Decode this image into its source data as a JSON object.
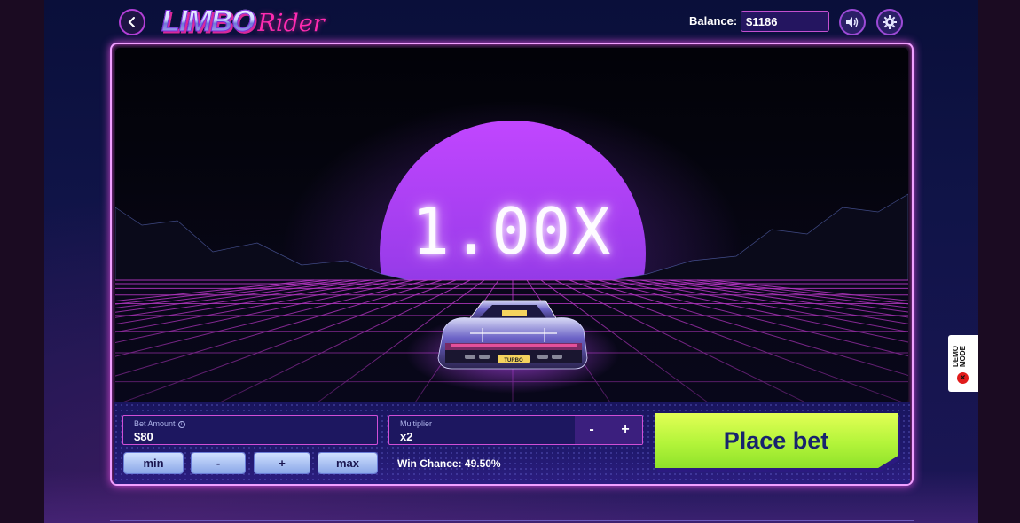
{
  "header": {
    "logo_primary": "LIMBO",
    "logo_secondary": "Rider",
    "balance_label": "Balance:",
    "balance_value": "$1186"
  },
  "game": {
    "multiplier_display": "1.00X",
    "car_plate": "TURBO"
  },
  "controls": {
    "bet_amount_label": "Bet Amount",
    "bet_amount_value": "$80",
    "multiplier_label": "Multiplier",
    "multiplier_value": "x2",
    "multiplier_minus": "-",
    "multiplier_plus": "+",
    "chip_min": "min",
    "chip_minus": "-",
    "chip_plus": "+",
    "chip_max": "max",
    "win_chance": "Win Chance: 49.50%",
    "place_bet_label": "Place bet"
  },
  "demo_badge": {
    "line1": "DEMO",
    "line2": "MODE"
  },
  "colors": {
    "accent_pink": "#d04fd6",
    "place_bet_green": "#c5fb45",
    "sun_purple": "#9b3fe6",
    "panel_blue": "#1d1760"
  },
  "icons": {
    "back": "chevron-left-icon",
    "sound": "speaker-icon",
    "settings": "gear-icon",
    "info": "info-icon",
    "demo": "close-icon"
  }
}
